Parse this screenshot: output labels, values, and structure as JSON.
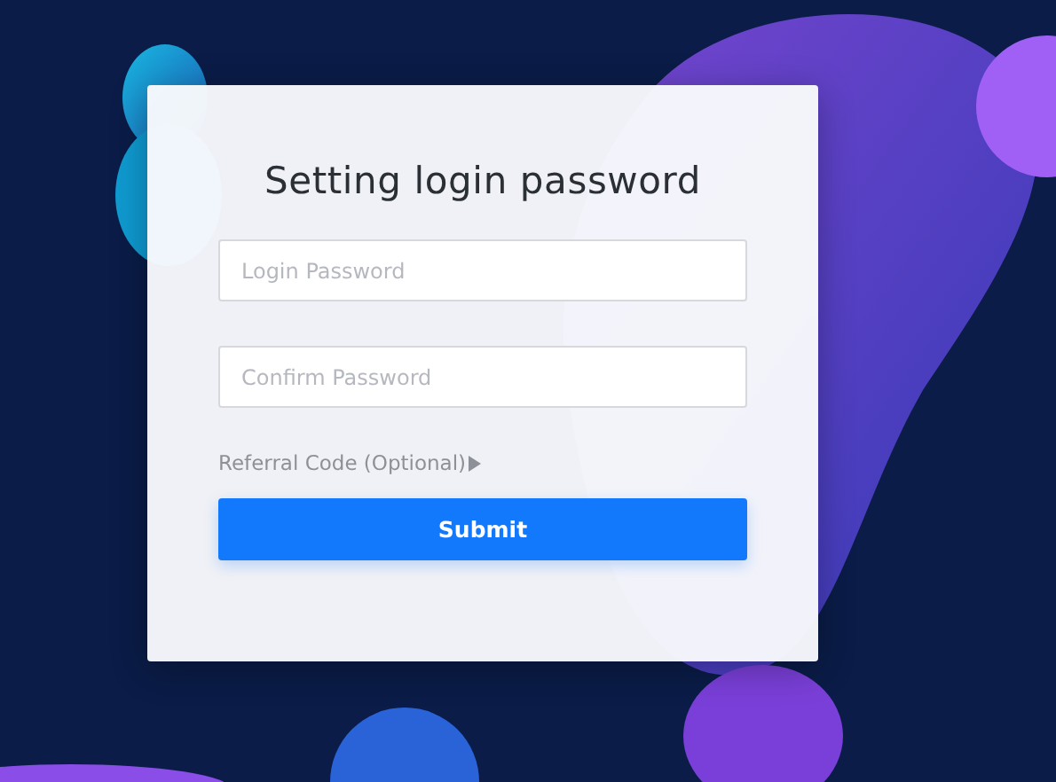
{
  "form": {
    "title": "Setting login password",
    "fields": [
      {
        "placeholder": "Login Password"
      },
      {
        "placeholder": "Confirm Password"
      }
    ],
    "referral": {
      "label": "Referral Code (Optional)",
      "expanded": false
    },
    "submit": {
      "label": "Submit"
    }
  }
}
